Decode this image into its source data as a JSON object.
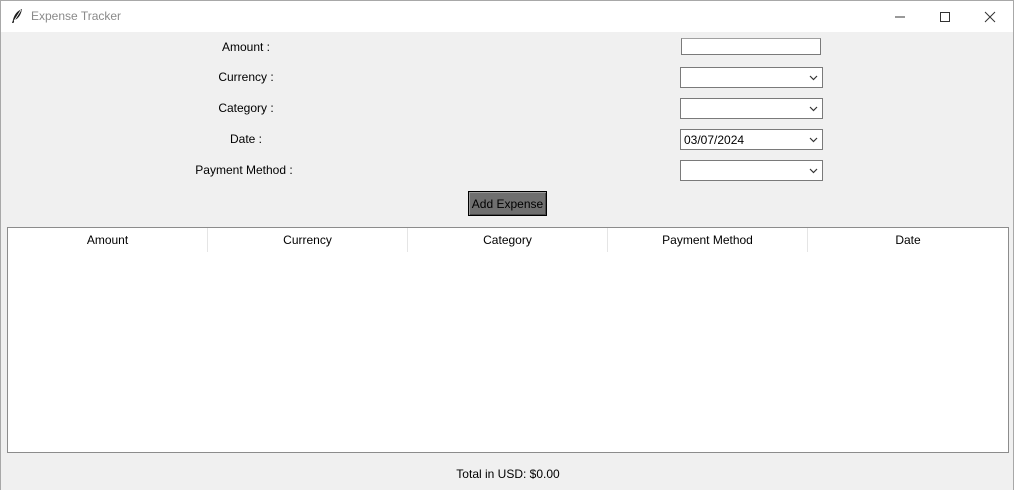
{
  "window": {
    "title": "Expense Tracker"
  },
  "form": {
    "amount_label": "Amount :",
    "amount_value": "",
    "currency_label": "Currency :",
    "currency_value": "",
    "category_label": "Category :",
    "category_value": "",
    "date_label": "Date :",
    "date_value": "03/07/2024",
    "payment_label": "Payment Method :",
    "payment_value": "",
    "add_button": "Add Expense"
  },
  "table": {
    "columns": [
      "Amount",
      "Currency",
      "Category",
      "Payment Method",
      "Date"
    ],
    "rows": []
  },
  "footer": {
    "total": "Total in USD: $0.00"
  },
  "icons": {
    "app": "feather-icon",
    "minimize": "minimize-icon",
    "maximize": "maximize-icon",
    "close": "close-icon",
    "dropdown": "chevron-down-icon"
  }
}
